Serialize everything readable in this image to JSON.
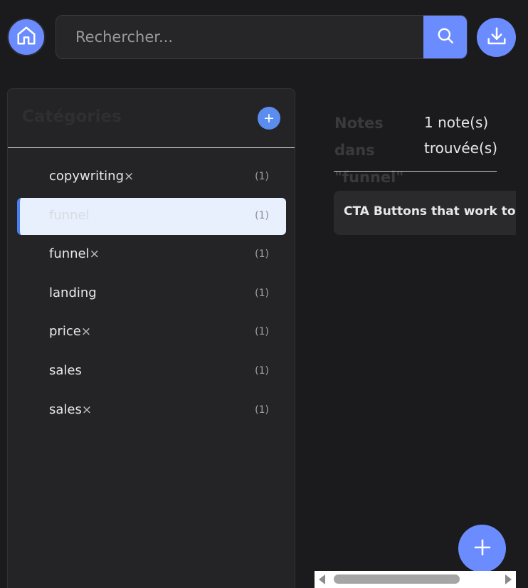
{
  "header": {
    "home_icon": "home-icon",
    "search": {
      "placeholder": "Rechercher...",
      "value": "",
      "icon": "search-icon"
    },
    "download_icon": "download-icon"
  },
  "sidebar": {
    "title": "Catégories",
    "add_label": "+",
    "items": [
      {
        "label": "copywriting",
        "remove": "×",
        "count": "(1)",
        "active": false
      },
      {
        "label": "funnel",
        "remove": "",
        "count": "(1)",
        "active": true
      },
      {
        "label": "funnel",
        "remove": "×",
        "count": "(1)",
        "active": false
      },
      {
        "label": "landing",
        "remove": "",
        "count": "(1)",
        "active": false
      },
      {
        "label": "price",
        "remove": "×",
        "count": "(1)",
        "active": false
      },
      {
        "label": "sales",
        "remove": "",
        "count": "(1)",
        "active": false
      },
      {
        "label": "sales",
        "remove": "×",
        "count": "(1)",
        "active": false
      }
    ]
  },
  "main": {
    "title": "Notes dans \"funnel\"",
    "count_text": "1 note(s) trouvée(s)",
    "notes": [
      {
        "title": "CTA Buttons that work to sell"
      }
    ]
  },
  "fab": {
    "label": "+",
    "icon": "plus-icon"
  },
  "colors": {
    "accent": "#6b8cff",
    "background": "#1b1b1d",
    "panel": "#242426",
    "active_bg": "#e8f0fd",
    "active_border": "#4a7ff0"
  }
}
